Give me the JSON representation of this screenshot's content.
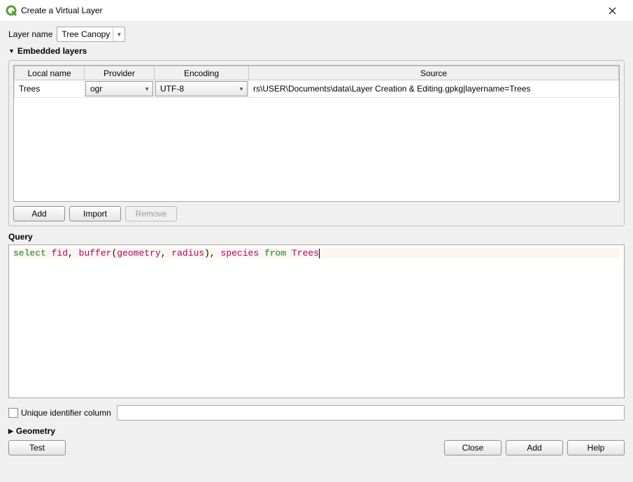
{
  "window": {
    "title": "Create a Virtual Layer"
  },
  "layerName": {
    "label": "Layer name",
    "value": "Tree Canopy"
  },
  "embedded": {
    "header": "Embedded layers",
    "columns": [
      "Local name",
      "Provider",
      "Encoding",
      "Source"
    ],
    "rows": [
      {
        "local_name": "Trees",
        "provider": "ogr",
        "encoding": "UTF-8",
        "source": "rs\\USER\\Documents\\data\\Layer Creation & Editing.gpkg|layername=Trees"
      }
    ],
    "buttons": {
      "add": "Add",
      "import": "Import",
      "remove": "Remove"
    }
  },
  "query": {
    "label": "Query",
    "tokens": [
      {
        "t": "kw",
        "v": "select"
      },
      {
        "t": "plain",
        "v": " "
      },
      {
        "t": "ident",
        "v": "fid"
      },
      {
        "t": "plain",
        "v": ", "
      },
      {
        "t": "ident",
        "v": "buffer"
      },
      {
        "t": "plain",
        "v": "("
      },
      {
        "t": "ident",
        "v": "geometry"
      },
      {
        "t": "plain",
        "v": ", "
      },
      {
        "t": "ident",
        "v": "radius"
      },
      {
        "t": "plain",
        "v": "), "
      },
      {
        "t": "ident",
        "v": "species"
      },
      {
        "t": "plain",
        "v": " "
      },
      {
        "t": "kw",
        "v": "from"
      },
      {
        "t": "plain",
        "v": " "
      },
      {
        "t": "ident",
        "v": "Trees"
      }
    ]
  },
  "uid": {
    "label": "Unique identifier column",
    "value": ""
  },
  "geometry": {
    "header": "Geometry"
  },
  "bottom": {
    "test": "Test",
    "close": "Close",
    "add": "Add",
    "help": "Help"
  }
}
